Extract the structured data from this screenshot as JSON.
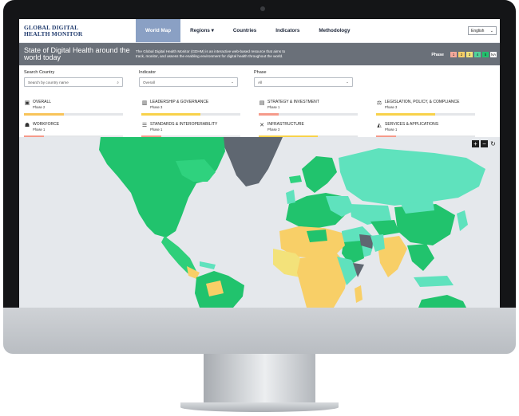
{
  "header": {
    "logo": [
      "GLOBAL DIGITAL",
      "HEALTH MONITOR"
    ],
    "nav": [
      {
        "label": "World Map",
        "active": true
      },
      {
        "label": "Regions ▾",
        "active": false
      },
      {
        "label": "Countries",
        "active": false
      },
      {
        "label": "Indicators",
        "active": false
      },
      {
        "label": "Methodology",
        "active": false
      }
    ],
    "language": "English"
  },
  "hero": {
    "title": "State of Digital Health around the world today",
    "description": "The Global Digital Health Monitor (GDHM) is an interactive web-based resource that aims to track, monitor, and assess the enabling environment for digital health throughout the world.",
    "phase_label": "Phase",
    "phases": [
      {
        "label": "1",
        "color": "#f6a99b"
      },
      {
        "label": "2",
        "color": "#f8cf67"
      },
      {
        "label": "3",
        "color": "#f3e27a"
      },
      {
        "label": "4",
        "color": "#4fd49a"
      },
      {
        "label": "5",
        "color": "#21c36d"
      },
      {
        "label": "NA",
        "color": "#ffffff"
      }
    ]
  },
  "filters": {
    "search_label": "Search Country",
    "search_placeholder": "Search by country name",
    "indicator_label": "Indicator",
    "indicator_value": "Overall",
    "phase_label": "Phase",
    "phase_value": "All"
  },
  "indicators": [
    {
      "title": "OVERALL",
      "phase": "Phase 2",
      "icon": "grid-icon",
      "glyph": "▣",
      "fill": 0.4,
      "color": "#f8c45a"
    },
    {
      "title": "LEADERSHIP & GOVERNANCE",
      "phase": "Phase 3",
      "icon": "bar-chart-icon",
      "glyph": "▥",
      "fill": 0.6,
      "color": "#f8d24a"
    },
    {
      "title": "STRATEGY & INVESTMENT",
      "phase": "Phase 1",
      "icon": "document-icon",
      "glyph": "▤",
      "fill": 0.2,
      "color": "#f59a8a"
    },
    {
      "title": "LEGISLATION, POLICY, & COMPLIANCE",
      "phase": "Phase 3",
      "icon": "scales-icon",
      "glyph": "⚖",
      "fill": 0.6,
      "color": "#f8d24a"
    },
    {
      "title": "WORKFORCE",
      "phase": "Phase 1",
      "icon": "people-icon",
      "glyph": "☗",
      "fill": 0.2,
      "color": "#f59a8a"
    },
    {
      "title": "STANDARDS & INTEROPERABILITY",
      "phase": "Phase 1",
      "icon": "standards-icon",
      "glyph": "☰",
      "fill": 0.2,
      "color": "#f59a8a"
    },
    {
      "title": "INFRASTRUCTURE",
      "phase": "Phase 3",
      "icon": "tools-icon",
      "glyph": "✕",
      "fill": 0.6,
      "color": "#f8d24a"
    },
    {
      "title": "SERVICES & APPLICATIONS",
      "phase": "Phase 1",
      "icon": "monitor-icon",
      "glyph": "◭",
      "fill": 0.2,
      "color": "#f59a8a"
    }
  ],
  "map_controls": {
    "zoom_in": "+",
    "zoom_out": "−",
    "reset": "↻"
  },
  "colors": {
    "nav_active": "#8aa0c4",
    "hero_bg": "#6a7079",
    "map_bg": "#e5e8ec",
    "phase5": "#21c36d",
    "phase4": "#58e0b8",
    "phase2": "#f8cf67",
    "na": "#5f6771"
  }
}
